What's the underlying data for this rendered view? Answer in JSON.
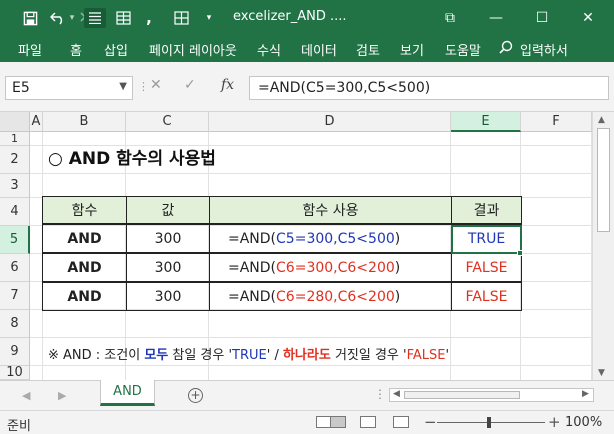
{
  "titlebar": {
    "title": "excelizer_AND ....",
    "icons": [
      "save-icon",
      "undo-icon",
      "redo-icon",
      "touch-mode-icon",
      "table-icon",
      "comma-icon",
      "border-icon",
      "customize-icon"
    ],
    "restore_glyph": "⧉",
    "minimize_glyph": "—",
    "maximize_glyph": "☐",
    "close_glyph": "✕"
  },
  "ribbon": {
    "tabs": [
      "파일",
      "홈",
      "삽입",
      "페이지 레이아웃",
      "수식",
      "데이터",
      "검토",
      "보기",
      "도움말"
    ],
    "search_label": "입력하서"
  },
  "formula_bar": {
    "name_box": "E5",
    "formula": "=AND(C5=300,C5<500)",
    "fx_label": "fx"
  },
  "columns": [
    "A",
    "B",
    "C",
    "D",
    "E",
    "F"
  ],
  "rows": [
    "1",
    "2",
    "3",
    "4",
    "5",
    "6",
    "7",
    "8",
    "9",
    "10"
  ],
  "selected_cell": {
    "col": "E",
    "row": "5"
  },
  "sheet": {
    "heading": "○ AND 함수의 사용법",
    "table": {
      "headers": [
        "함수",
        "값",
        "함수 사용",
        "결과"
      ],
      "rows": [
        {
          "func": "AND",
          "value": "300",
          "formula_prefix": "=AND(",
          "arg1": "C5=300",
          "sep": ",",
          "arg2": "C5<500",
          "formula_suffix": ")",
          "args_color": "#1f37b4",
          "result": "TRUE",
          "result_color": "#1f37b4"
        },
        {
          "func": "AND",
          "value": "300",
          "formula_prefix": "=AND(",
          "arg1": "C6=300",
          "sep": ",",
          "arg2": "C6<200",
          "formula_suffix": ")",
          "args_color": "#e03020",
          "result": "FALSE",
          "result_color": "#e03020"
        },
        {
          "func": "AND",
          "value": "300",
          "formula_prefix": "=AND(",
          "arg1": "C6=280",
          "sep": ",",
          "arg2": "C6<200",
          "formula_suffix": ")",
          "args_color": "#e03020",
          "result": "FALSE",
          "result_color": "#e03020"
        }
      ]
    },
    "note": {
      "p1": "※ AND : 조건이 ",
      "p2": "모두",
      "p3": " 참일 경우 '",
      "p4": "TRUE",
      "p5": "' / ",
      "p6": "하나라도",
      "p7": " 거짓일 경우 '",
      "p8": "FALSE",
      "p9": "'"
    }
  },
  "sheet_tabs": {
    "active": "AND",
    "add_label": "+",
    "more_label": "⋮"
  },
  "statusbar": {
    "ready": "준비",
    "zoom": "100%",
    "zoom_minus": "−",
    "zoom_plus": "+"
  },
  "colors": {
    "excel_green": "#217346",
    "header_fill": "#e2f0d9",
    "true_blue": "#1f37b4",
    "false_red": "#e03020"
  }
}
